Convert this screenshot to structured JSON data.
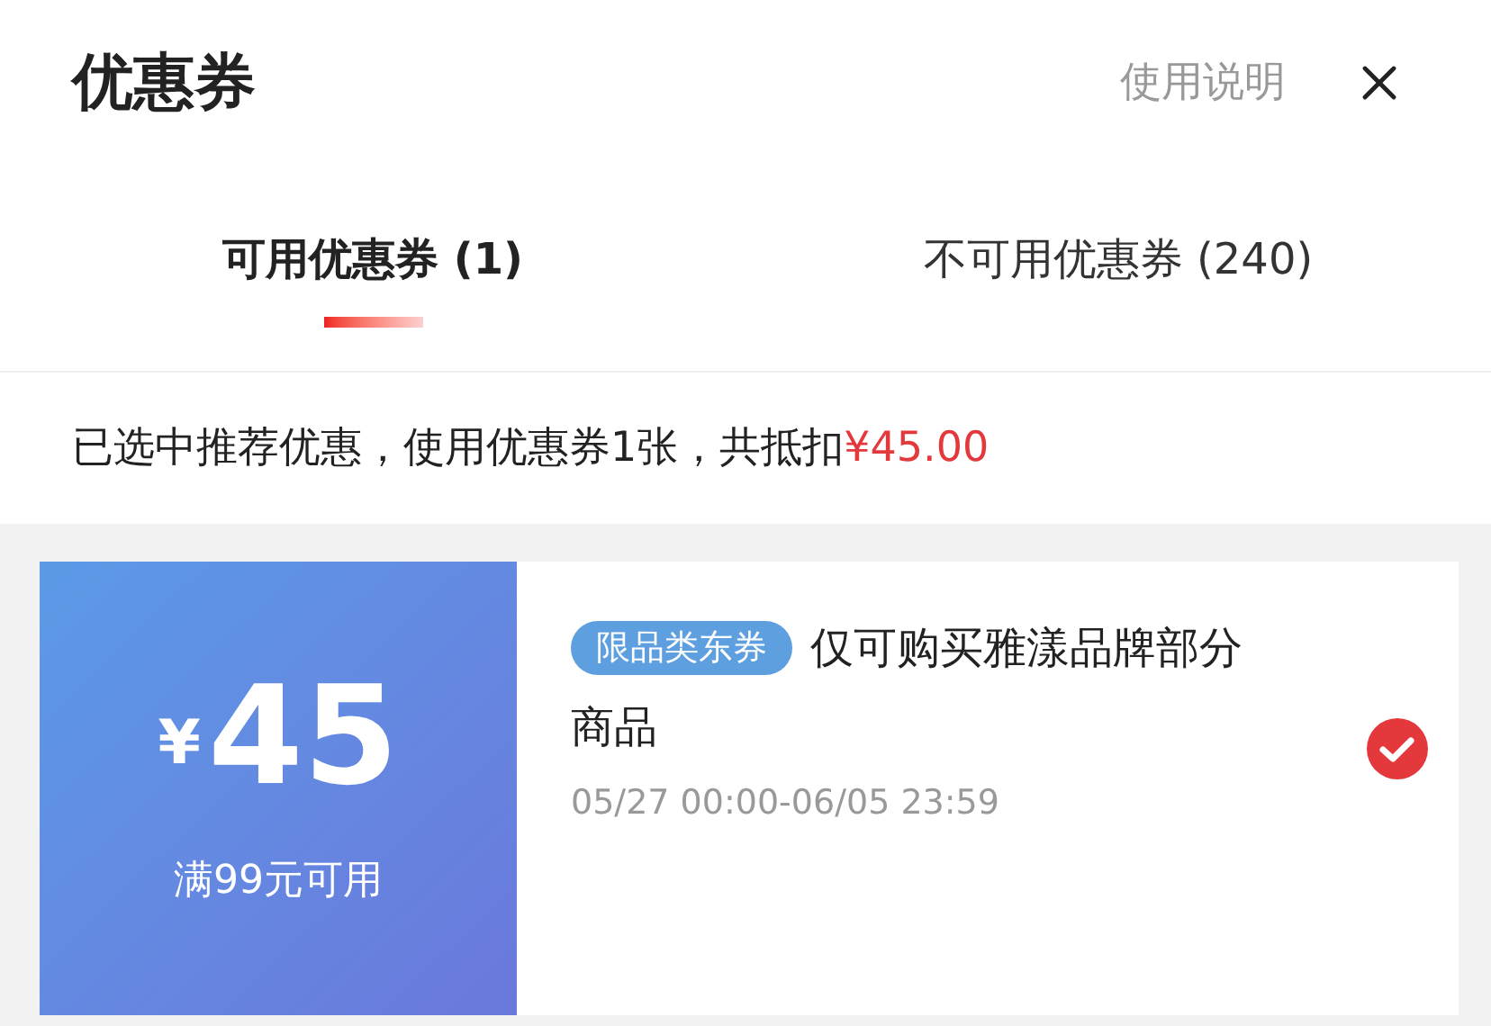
{
  "header": {
    "title": "优惠券",
    "help_link": "使用说明"
  },
  "tabs": [
    {
      "label": "可用优惠券 (1)",
      "selected": true
    },
    {
      "label": "不可用优惠券 (240)",
      "selected": false
    }
  ],
  "summary": {
    "text": "已选中推荐优惠，使用优惠券1张，共抵扣",
    "amount": "¥45.00"
  },
  "coupons": [
    {
      "currency": "¥",
      "amount": "45",
      "condition": "满99元可用",
      "tag": "限品类东券",
      "description_lines": [
        "仅可购买雅漾品牌部分",
        "商品"
      ],
      "validity": "05/27 00:00-06/05 23:59",
      "selected": true
    }
  ]
}
